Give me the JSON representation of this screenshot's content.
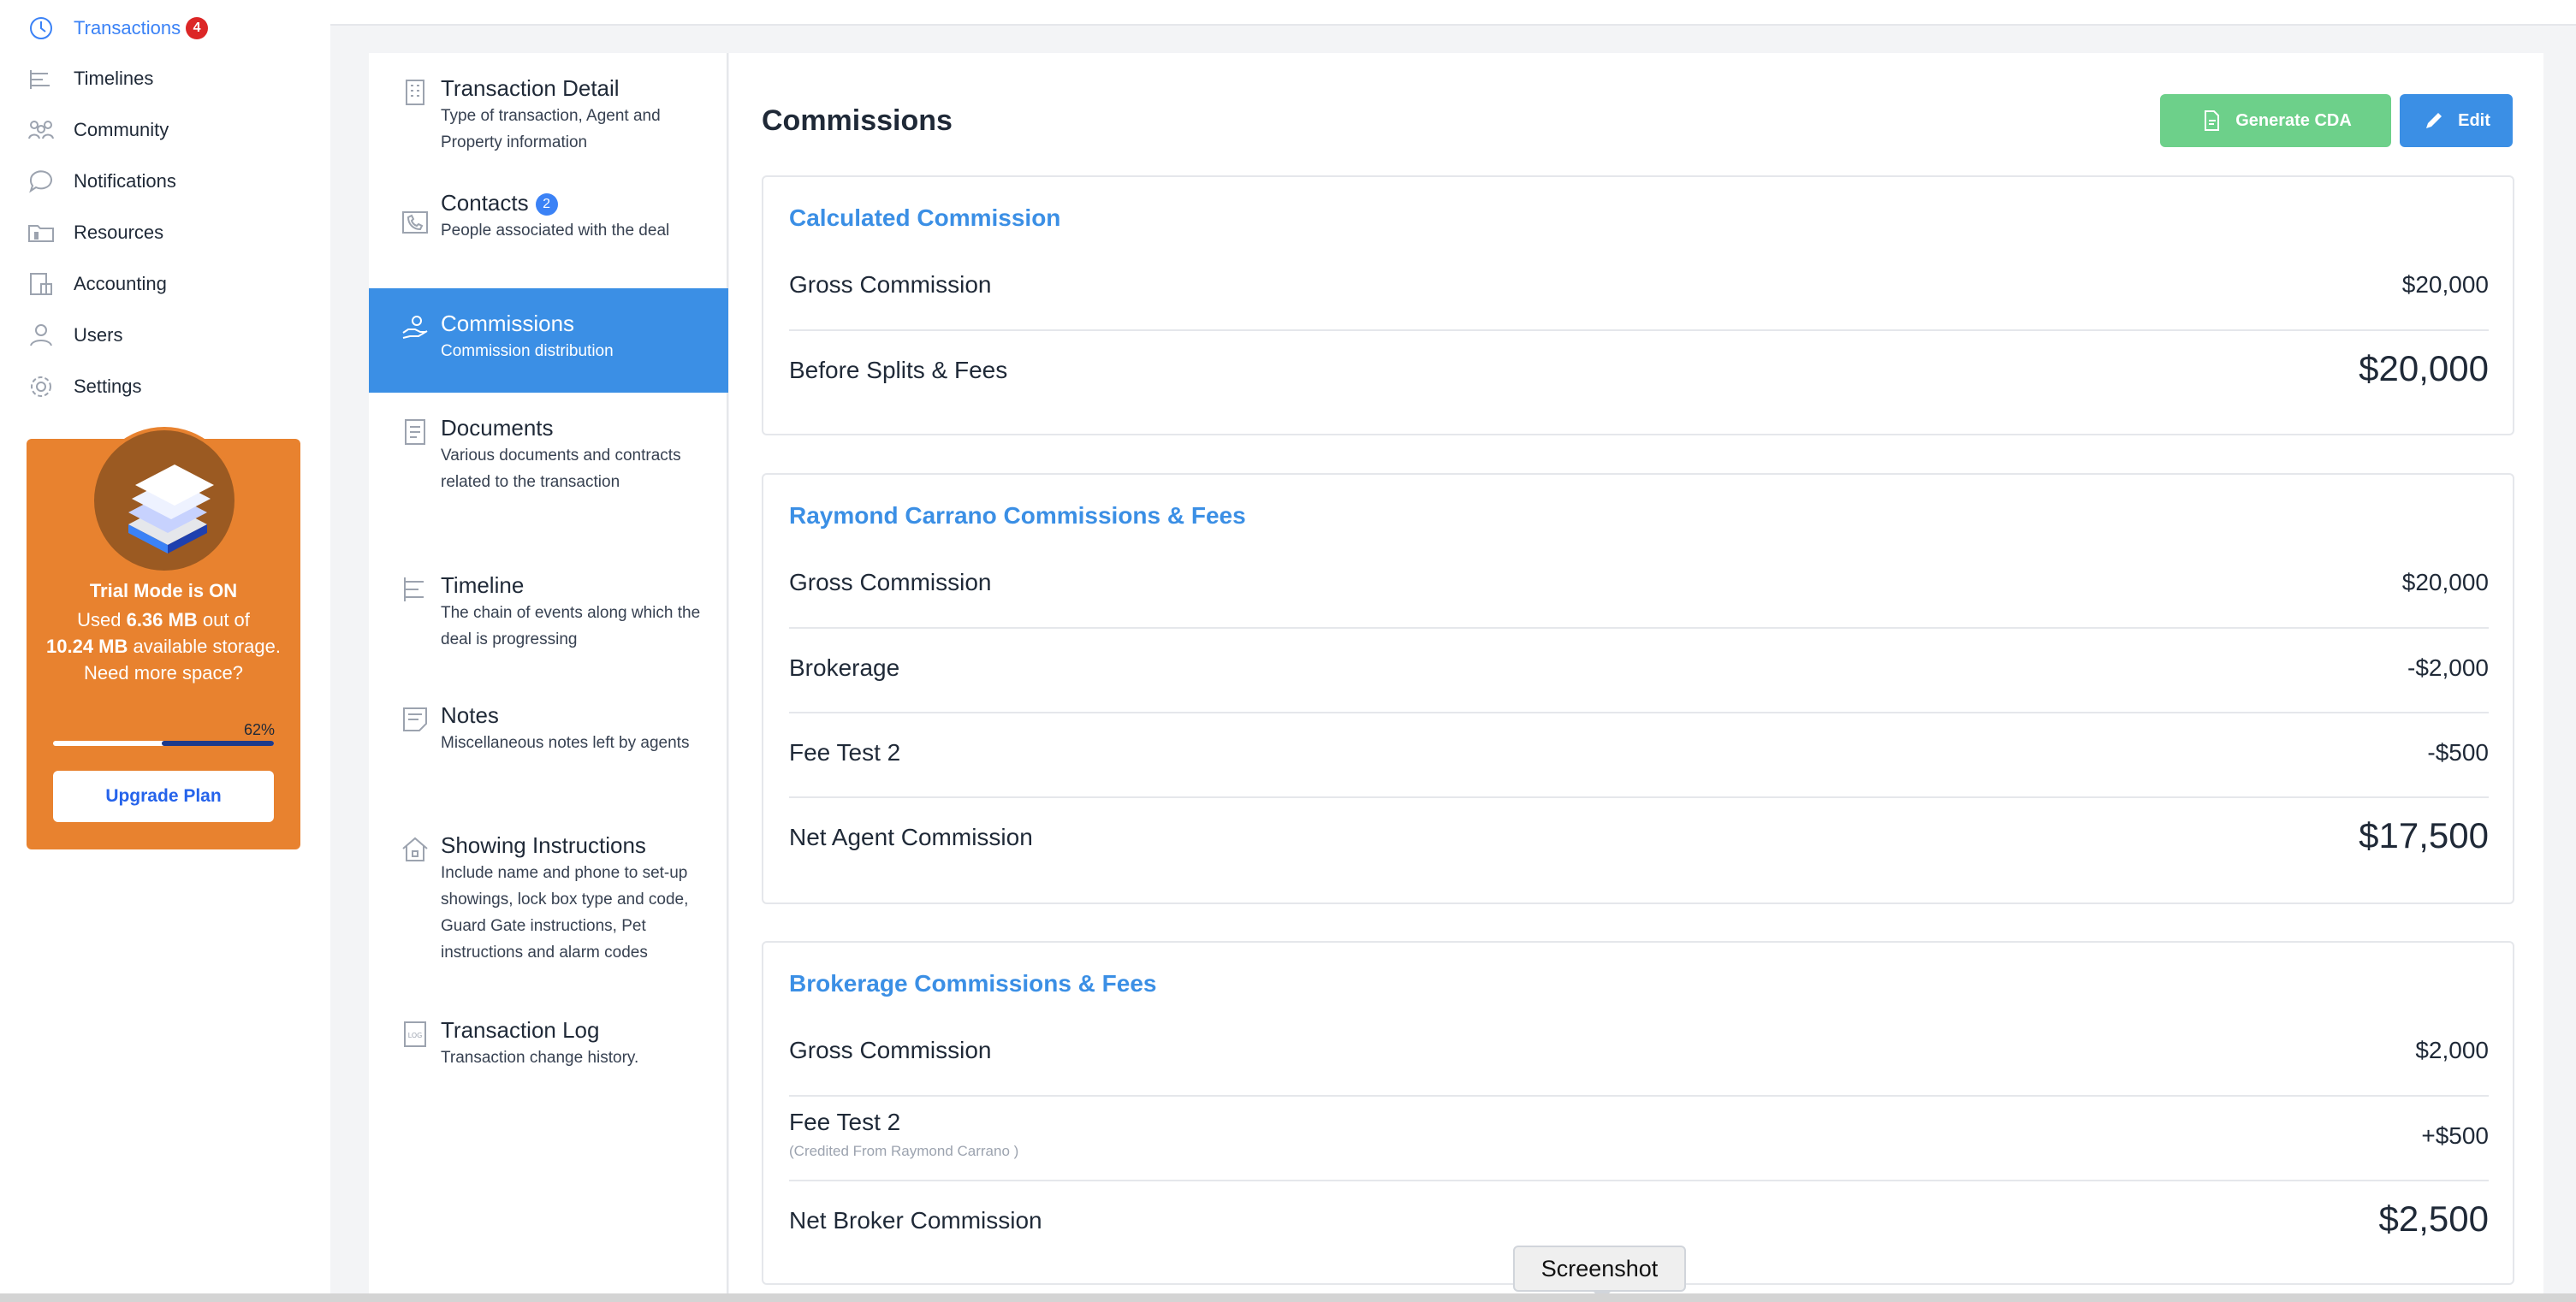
{
  "sidebar": {
    "items": [
      {
        "label": "Transactions",
        "icon": "transactions-icon",
        "badge": "4",
        "active": true
      },
      {
        "label": "Timelines",
        "icon": "timelines-icon"
      },
      {
        "label": "Community",
        "icon": "community-icon"
      },
      {
        "label": "Notifications",
        "icon": "notifications-icon"
      },
      {
        "label": "Resources",
        "icon": "resources-icon"
      },
      {
        "label": "Accounting",
        "icon": "accounting-icon"
      },
      {
        "label": "Users",
        "icon": "users-icon"
      },
      {
        "label": "Settings",
        "icon": "settings-icon"
      }
    ]
  },
  "trial": {
    "title": "Trial Mode is ON",
    "used_prefix": "Used",
    "used_value": "6.36 MB",
    "used_mid": "out of",
    "total_value": "10.24 MB",
    "total_suffix": "available storage.",
    "need_more": "Need more space?",
    "percent_label": "62%",
    "percent": 62,
    "upgrade_label": "Upgrade Plan"
  },
  "sections": [
    {
      "title": "Transaction Detail",
      "desc": "Type of transaction, Agent and Property information",
      "icon": "building-icon"
    },
    {
      "title": "Contacts",
      "badge": "2",
      "desc": "People associated with the deal",
      "icon": "phone-book-icon"
    },
    {
      "title": "Commissions",
      "desc": "Commission distribution",
      "icon": "hand-money-icon",
      "active": true
    },
    {
      "title": "Documents",
      "desc": "Various documents and contracts related to the transaction",
      "icon": "document-icon"
    },
    {
      "title": "Timeline",
      "desc": "The chain of events along which the deal is progressing",
      "icon": "timeline-icon"
    },
    {
      "title": "Notes",
      "desc": "Miscellaneous notes left by agents",
      "icon": "note-icon"
    },
    {
      "title": "Showing Instructions",
      "desc": "Include name and phone to set-up showings, lock box type and code, Guard Gate instructions, Pet instructions and alarm codes",
      "icon": "house-icon"
    },
    {
      "title": "Transaction Log",
      "desc": "Transaction change history.",
      "icon": "log-icon"
    }
  ],
  "main": {
    "title": "Commissions",
    "generate_label": "Generate CDA",
    "edit_label": "Edit",
    "colors": {
      "accent": "#3b8fe5",
      "green": "#6dd08a",
      "orange": "#e8822f"
    }
  },
  "cards": [
    {
      "title": "Calculated Commission",
      "rows": [
        {
          "label": "Gross Commission",
          "value": "$20,000"
        },
        {
          "label": "Before Splits & Fees",
          "value": "$20,000",
          "big": true
        }
      ]
    },
    {
      "title": "Raymond Carrano Commissions & Fees",
      "rows": [
        {
          "label": "Gross Commission",
          "value": "$20,000"
        },
        {
          "label": "Brokerage",
          "value": "-$2,000"
        },
        {
          "label": "Fee Test 2",
          "value": "-$500"
        },
        {
          "label": "Net Agent Commission",
          "value": "$17,500",
          "big": true
        }
      ]
    },
    {
      "title": "Brokerage Commissions & Fees",
      "rows": [
        {
          "label": "Gross Commission",
          "value": "$2,000"
        },
        {
          "label": "Fee Test 2",
          "sub": "(Credited From Raymond Carrano )",
          "value": "+$500"
        },
        {
          "label": "Net Broker Commission",
          "value": "$2,500",
          "big": true
        }
      ]
    }
  ],
  "tooltip": "Screenshot"
}
